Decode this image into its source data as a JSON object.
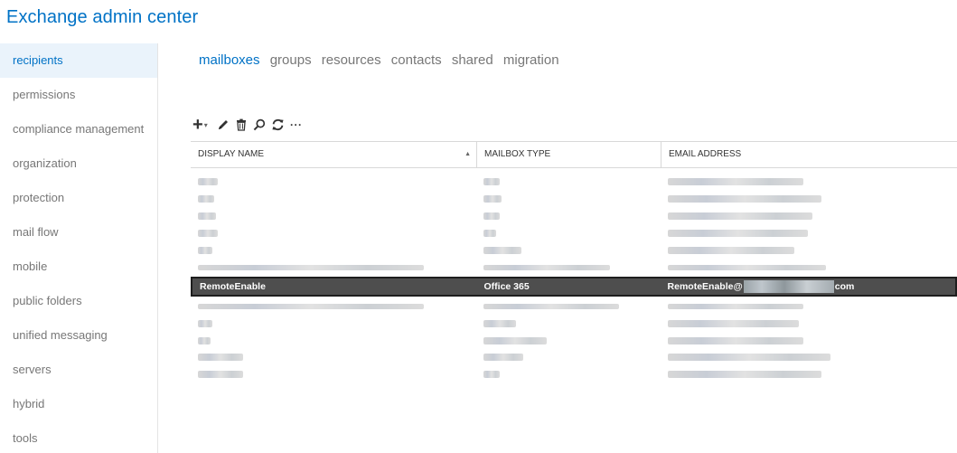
{
  "app": {
    "title": "Exchange admin center"
  },
  "sidebar": {
    "items": [
      {
        "label": "recipients",
        "selected": true
      },
      {
        "label": "permissions"
      },
      {
        "label": "compliance management"
      },
      {
        "label": "organization"
      },
      {
        "label": "protection"
      },
      {
        "label": "mail flow"
      },
      {
        "label": "mobile"
      },
      {
        "label": "public folders"
      },
      {
        "label": "unified messaging"
      },
      {
        "label": "servers"
      },
      {
        "label": "hybrid"
      },
      {
        "label": "tools"
      }
    ]
  },
  "tabs": [
    {
      "label": "mailboxes",
      "active": true
    },
    {
      "label": "groups"
    },
    {
      "label": "resources"
    },
    {
      "label": "contacts"
    },
    {
      "label": "shared"
    },
    {
      "label": "migration"
    }
  ],
  "toolbar": {
    "icons": [
      "add-icon",
      "edit-icon",
      "delete-icon",
      "search-icon",
      "refresh-icon",
      "more-icon"
    ],
    "add_symbol": "+",
    "caret_symbol": "▾",
    "more_symbol": "···"
  },
  "grid": {
    "columns": [
      {
        "label": "DISPLAY NAME",
        "sort": "ascending"
      },
      {
        "label": "MAILBOX TYPE"
      },
      {
        "label": "EMAIL ADDRESS"
      }
    ],
    "sort_arrow": "▲",
    "selected_row": {
      "display_name": "RemoteEnable",
      "mailbox_type": "Office 365",
      "email_prefix": "RemoteEnable@",
      "email_suffix": "com"
    }
  },
  "colors": {
    "accent": "#0072c6",
    "sidebar_selected_bg": "#eaf3fb",
    "selected_row_bg": "#4e4e4e"
  }
}
